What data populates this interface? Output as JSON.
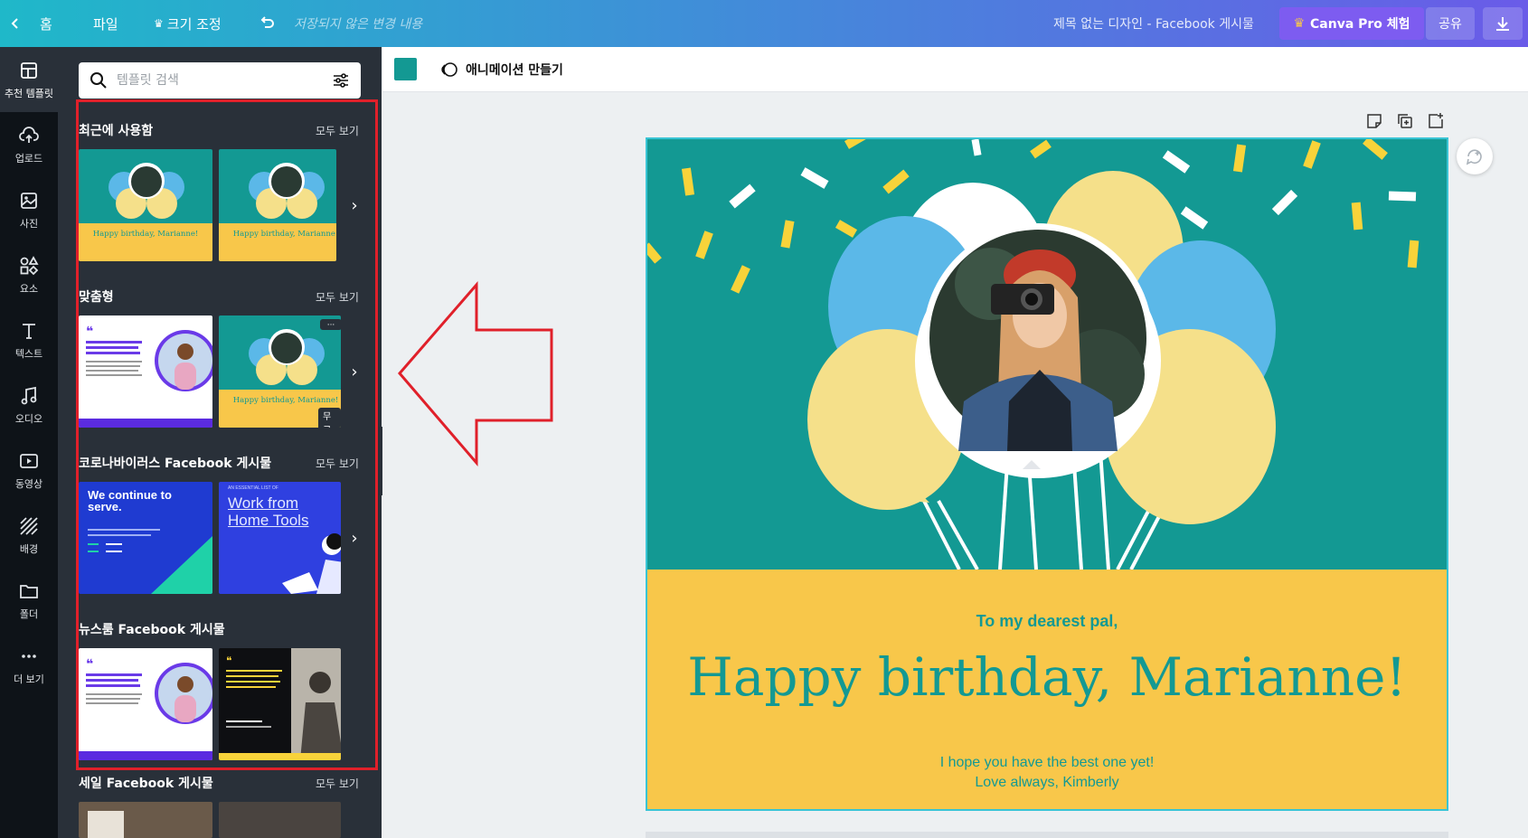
{
  "topbar": {
    "home_label": "홈",
    "file_label": "파일",
    "resize_label": "크기 조정",
    "unsaved_text": "저장되지 않은 변경 내용",
    "doc_title": "제목 없는 디자인 - Facebook 게시물",
    "pro_label": "Canva Pro 체험",
    "share_label": "공유"
  },
  "nav": {
    "items": [
      {
        "label": "추천 템플릿",
        "icon": "template-icon"
      },
      {
        "label": "업로드",
        "icon": "upload-cloud-icon"
      },
      {
        "label": "사진",
        "icon": "image-icon"
      },
      {
        "label": "요소",
        "icon": "shapes-icon"
      },
      {
        "label": "텍스트",
        "icon": "text-icon"
      },
      {
        "label": "오디오",
        "icon": "music-note-icon"
      },
      {
        "label": "동영상",
        "icon": "video-icon"
      },
      {
        "label": "배경",
        "icon": "background-pattern-icon"
      },
      {
        "label": "폴더",
        "icon": "folder-icon"
      },
      {
        "label": "더 보기",
        "icon": "more-dots-icon"
      }
    ]
  },
  "panel": {
    "search_placeholder": "템플릿 검색",
    "see_all": "모두 보기",
    "sections": [
      {
        "title": "최근에 사용함"
      },
      {
        "title": "맞춤형"
      },
      {
        "title": "코로나바이러스 Facebook 게시물"
      },
      {
        "title": "뉴스룸 Facebook 게시물"
      },
      {
        "title": "세일 Facebook 게시물"
      }
    ],
    "thumb_texts": {
      "birthday": "Happy birthday, Marianne!",
      "free_badge": "무료",
      "continue_serve": "We continue to serve.",
      "work_home": "Work from Home Tools",
      "work_home_kicker": "AN ESSENTIAL LIST OF"
    }
  },
  "toolbar2": {
    "swatch_color": "#139993",
    "animate_label": "애니메이션 만들기"
  },
  "design": {
    "greeting": "To my dearest pal,",
    "headline": "Happy birthday, Marianne!",
    "message_line1": "I hope you have the best one yet!",
    "message_line2": "Love always, Kimberly",
    "bg_color": "#139993",
    "panel_color": "#f8c74a"
  }
}
